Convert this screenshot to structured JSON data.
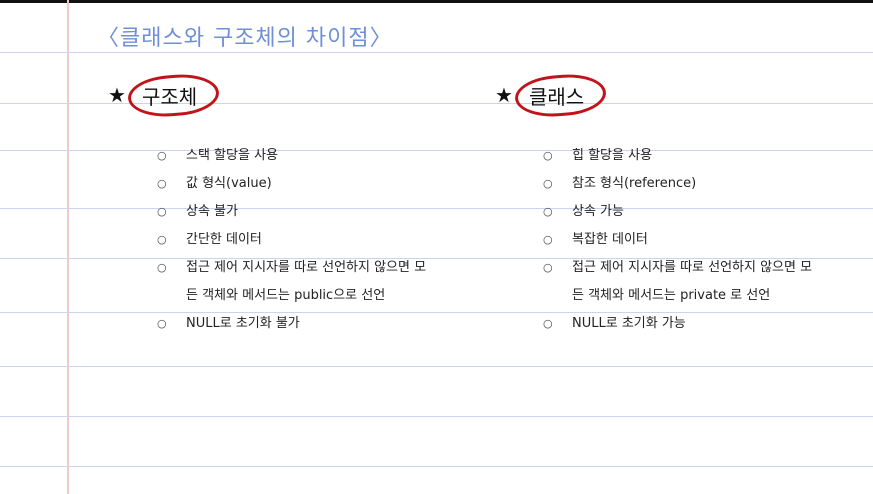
{
  "title": "〈클래스와 구조체의 차이점〉",
  "left": {
    "heading": "구조체",
    "items": [
      {
        "text": "스택 할당을 사용"
      },
      {
        "text": "값 형식(value)"
      },
      {
        "text": "상속 불가"
      },
      {
        "text": "간단한 데이터"
      },
      {
        "text": "접근 제어 지시자를 따로 선언하지 않으면 모",
        "cont": "든 객체와 메서드는 public으로 선언"
      },
      {
        "text": "NULL로 초기화 불가"
      }
    ]
  },
  "right": {
    "heading": "클래스",
    "items": [
      {
        "text": "힙 할당을 사용"
      },
      {
        "text": "참조 형식(reference)"
      },
      {
        "text": "상속 가능"
      },
      {
        "text": "복잡한 데이터"
      },
      {
        "text": "접근 제어 지시자를 따로 선언하지 않으면 모",
        "cont": "든 객체와 메서드는 private 로 선언"
      },
      {
        "text": "NULL로 초기화 가능"
      }
    ]
  },
  "bullet_glyph": "○",
  "star_glyph": "★",
  "colors": {
    "title": "#6f8fd6",
    "circle": "#c0141a",
    "rule": "#c9d5ee",
    "margin": "#f2c9c9"
  }
}
